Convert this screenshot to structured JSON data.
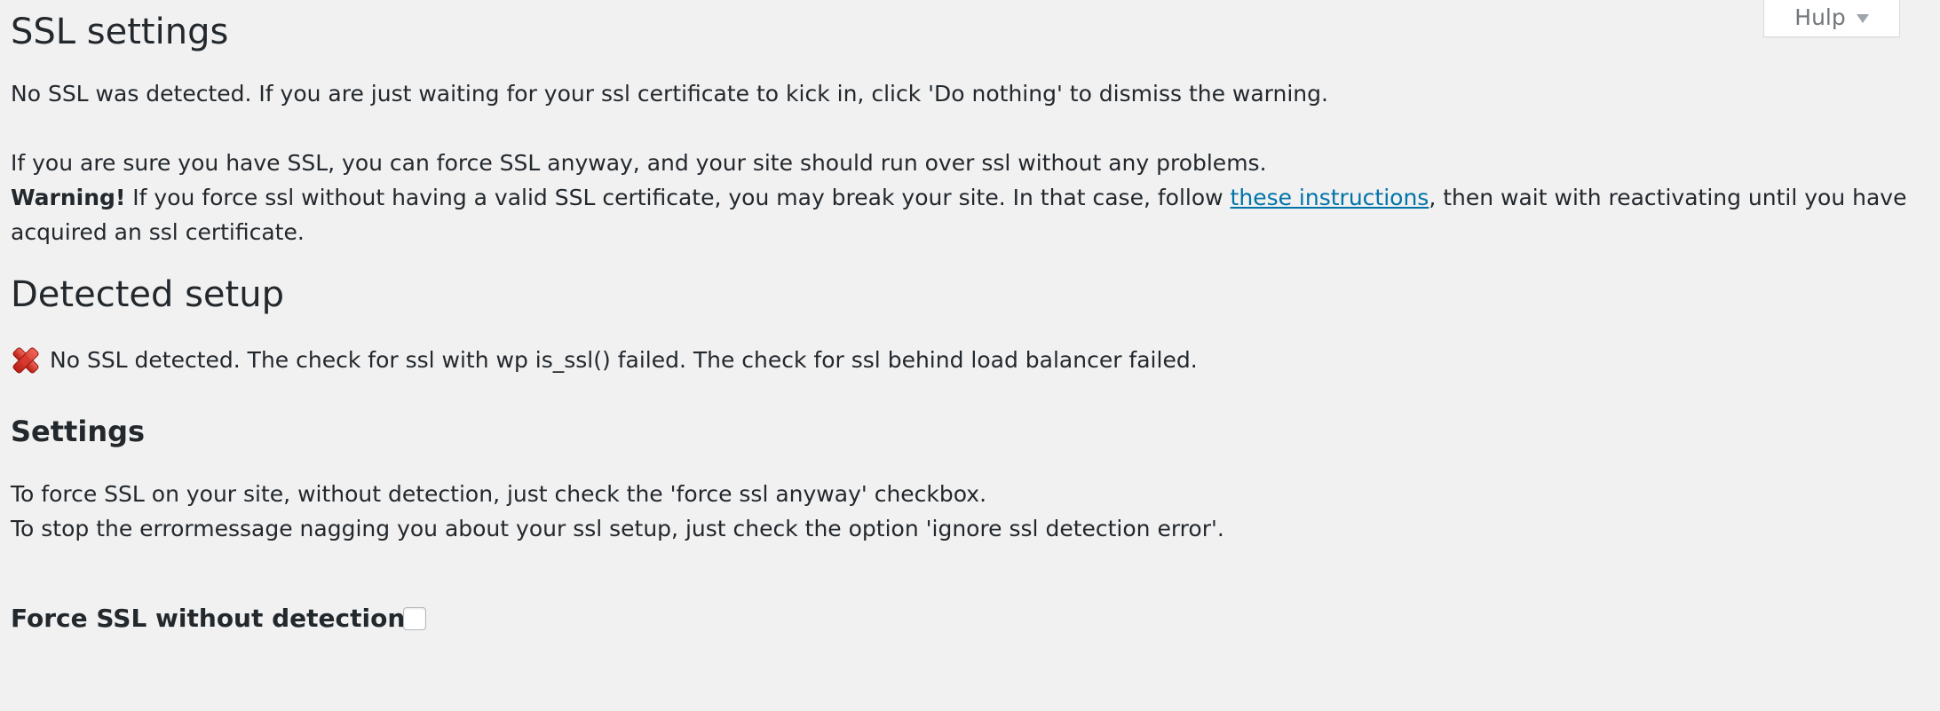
{
  "help_tab": {
    "label": "Hulp"
  },
  "ssl_settings": {
    "title": "SSL settings",
    "no_ssl_text": "No SSL was detected. If you are just waiting for your ssl certificate to kick in, click 'Do nothing' to dismiss the warning.",
    "sure_text": "If you are sure you have SSL, you can force SSL anyway, and your site should run over ssl without any problems.",
    "warning_label": "Warning!",
    "warning_text_before": " If you force ssl without having a valid SSL certificate, you may break your site. In that case, follow ",
    "warning_link": "these instructions",
    "warning_text_after": ", then wait with reactivating until you have acquired an ssl certificate."
  },
  "detected_setup": {
    "title": "Detected setup",
    "status_icon": "red-x-icon",
    "status_text": "No SSL detected. The check for ssl with wp is_ssl() failed. The check for ssl behind load balancer failed."
  },
  "settings": {
    "title": "Settings",
    "line1": "To force SSL on your site, without detection, just check the 'force ssl anyway' checkbox.",
    "line2": "To stop the errormessage nagging you about your ssl setup, just check the option 'ignore ssl detection error'.",
    "force_ssl_label": "Force SSL without detection",
    "force_ssl_checked": false
  }
}
